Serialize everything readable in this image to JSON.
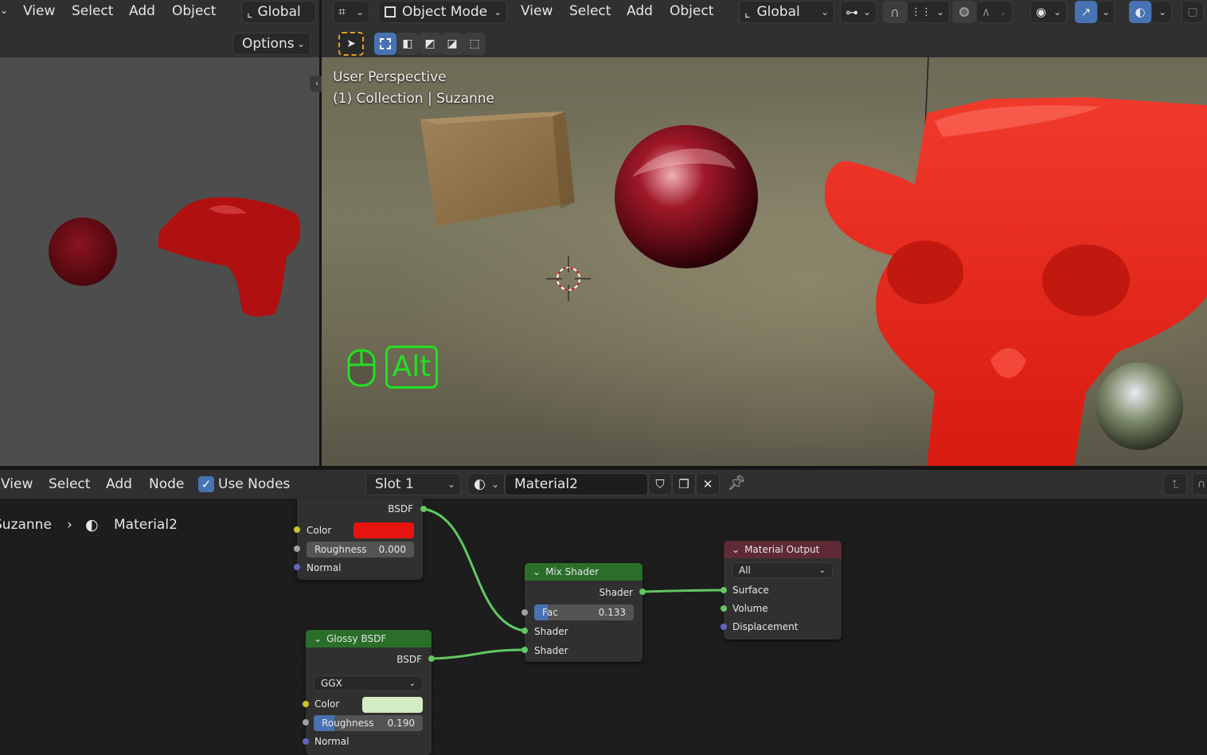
{
  "left_header": {
    "menu": [
      "View",
      "Select",
      "Add",
      "Object"
    ],
    "transform_orientation": "Global",
    "options_label": "Options"
  },
  "viewport_header": {
    "mode": "Object Mode",
    "menu": [
      "View",
      "Select",
      "Add",
      "Object"
    ],
    "transform_orientation": "Global"
  },
  "viewport": {
    "overlay_line1": "User Perspective",
    "overlay_line2": "(1) Collection | Suzanne",
    "key_hint": "Alt"
  },
  "node_header": {
    "menu": [
      "View",
      "Select",
      "Add",
      "Node"
    ],
    "use_nodes_label": "Use Nodes",
    "use_nodes_checked": true,
    "slot": "Slot 1",
    "material_name": "Material2"
  },
  "breadcrumb": {
    "object": "Suzanne",
    "material": "Material2"
  },
  "nodes": {
    "diffuse": {
      "output": "BSDF",
      "color_label": "Color",
      "color_value": "#e8140f",
      "roughness_label": "Roughness",
      "roughness_value": "0.000",
      "normal_label": "Normal"
    },
    "glossy": {
      "title": "Glossy BSDF",
      "output": "BSDF",
      "distribution": "GGX",
      "color_label": "Color",
      "color_value": "#d4ecc4",
      "roughness_label": "Roughness",
      "roughness_value": "0.190",
      "roughness_fraction": 0.19,
      "normal_label": "Normal"
    },
    "mix": {
      "title": "Mix Shader",
      "output": "Shader",
      "fac_label": "Fac",
      "fac_value": "0.133",
      "fac_fraction": 0.133,
      "input1": "Shader",
      "input2": "Shader"
    },
    "output": {
      "title": "Material Output",
      "target": "All",
      "surface": "Surface",
      "volume": "Volume",
      "displacement": "Displacement"
    }
  },
  "colors": {
    "shader_header": "#2a6e2a",
    "output_header": "#5e2a35",
    "accent": "#4772b3",
    "socket_green": "#63c763"
  }
}
